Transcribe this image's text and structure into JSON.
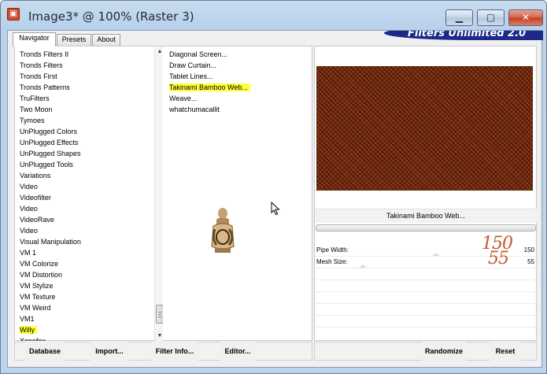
{
  "window": {
    "title": "Image3* @ 100% (Raster 3)"
  },
  "tabs": [
    {
      "label": "Navigator",
      "active": true
    },
    {
      "label": "Presets",
      "active": false
    },
    {
      "label": "About",
      "active": false
    }
  ],
  "brand": {
    "text": "Filters Unlimited 2.0"
  },
  "categories": {
    "items": [
      "Tronds Filters II",
      "Tronds Filters",
      "Tronds First",
      "Tronds Patterns",
      "TruFilters",
      "Two Moon",
      "Tymoes",
      "UnPlugged Colors",
      "UnPlugged Effects",
      "UnPlugged Shapes",
      "UnPlugged Tools",
      "Variations",
      "Video",
      "Videofilter",
      "Video",
      "VideoRave",
      "Video",
      "Visual Manipulation",
      "VM 1",
      "VM Colorize",
      "VM Distortion",
      "VM Stylize",
      "VM Texture",
      "VM Weird",
      "VM1",
      "Willy",
      "Xenofex"
    ],
    "selected": "Willy"
  },
  "filters": {
    "items": [
      "Diagonal Screen...",
      "Draw Curtain...",
      "Tablet Lines...",
      "Takinami Bamboo Web...",
      "Weave...",
      "whatchumacallit"
    ],
    "selected": "Takinami Bamboo Web..."
  },
  "preview": {
    "filter_name": "Takinami Bamboo Web..."
  },
  "params": [
    {
      "label": "Pipe Width:",
      "value": "150",
      "level": 150
    },
    {
      "label": "Mesh Size:",
      "value": "55",
      "level": 55
    }
  ],
  "annotations": {
    "pipe_width": "150",
    "mesh_size": "55"
  },
  "buttons": {
    "database": "Database",
    "import": "Import...",
    "filter_info": "Filter Info...",
    "editor": "Editor...",
    "randomize": "Randomize",
    "reset": "Reset"
  },
  "colors": {
    "highlight": "#ffff3a",
    "preview_base": "#8a3515",
    "brand_blue": "#1d2a8a",
    "annotation": "#c35a2a"
  }
}
